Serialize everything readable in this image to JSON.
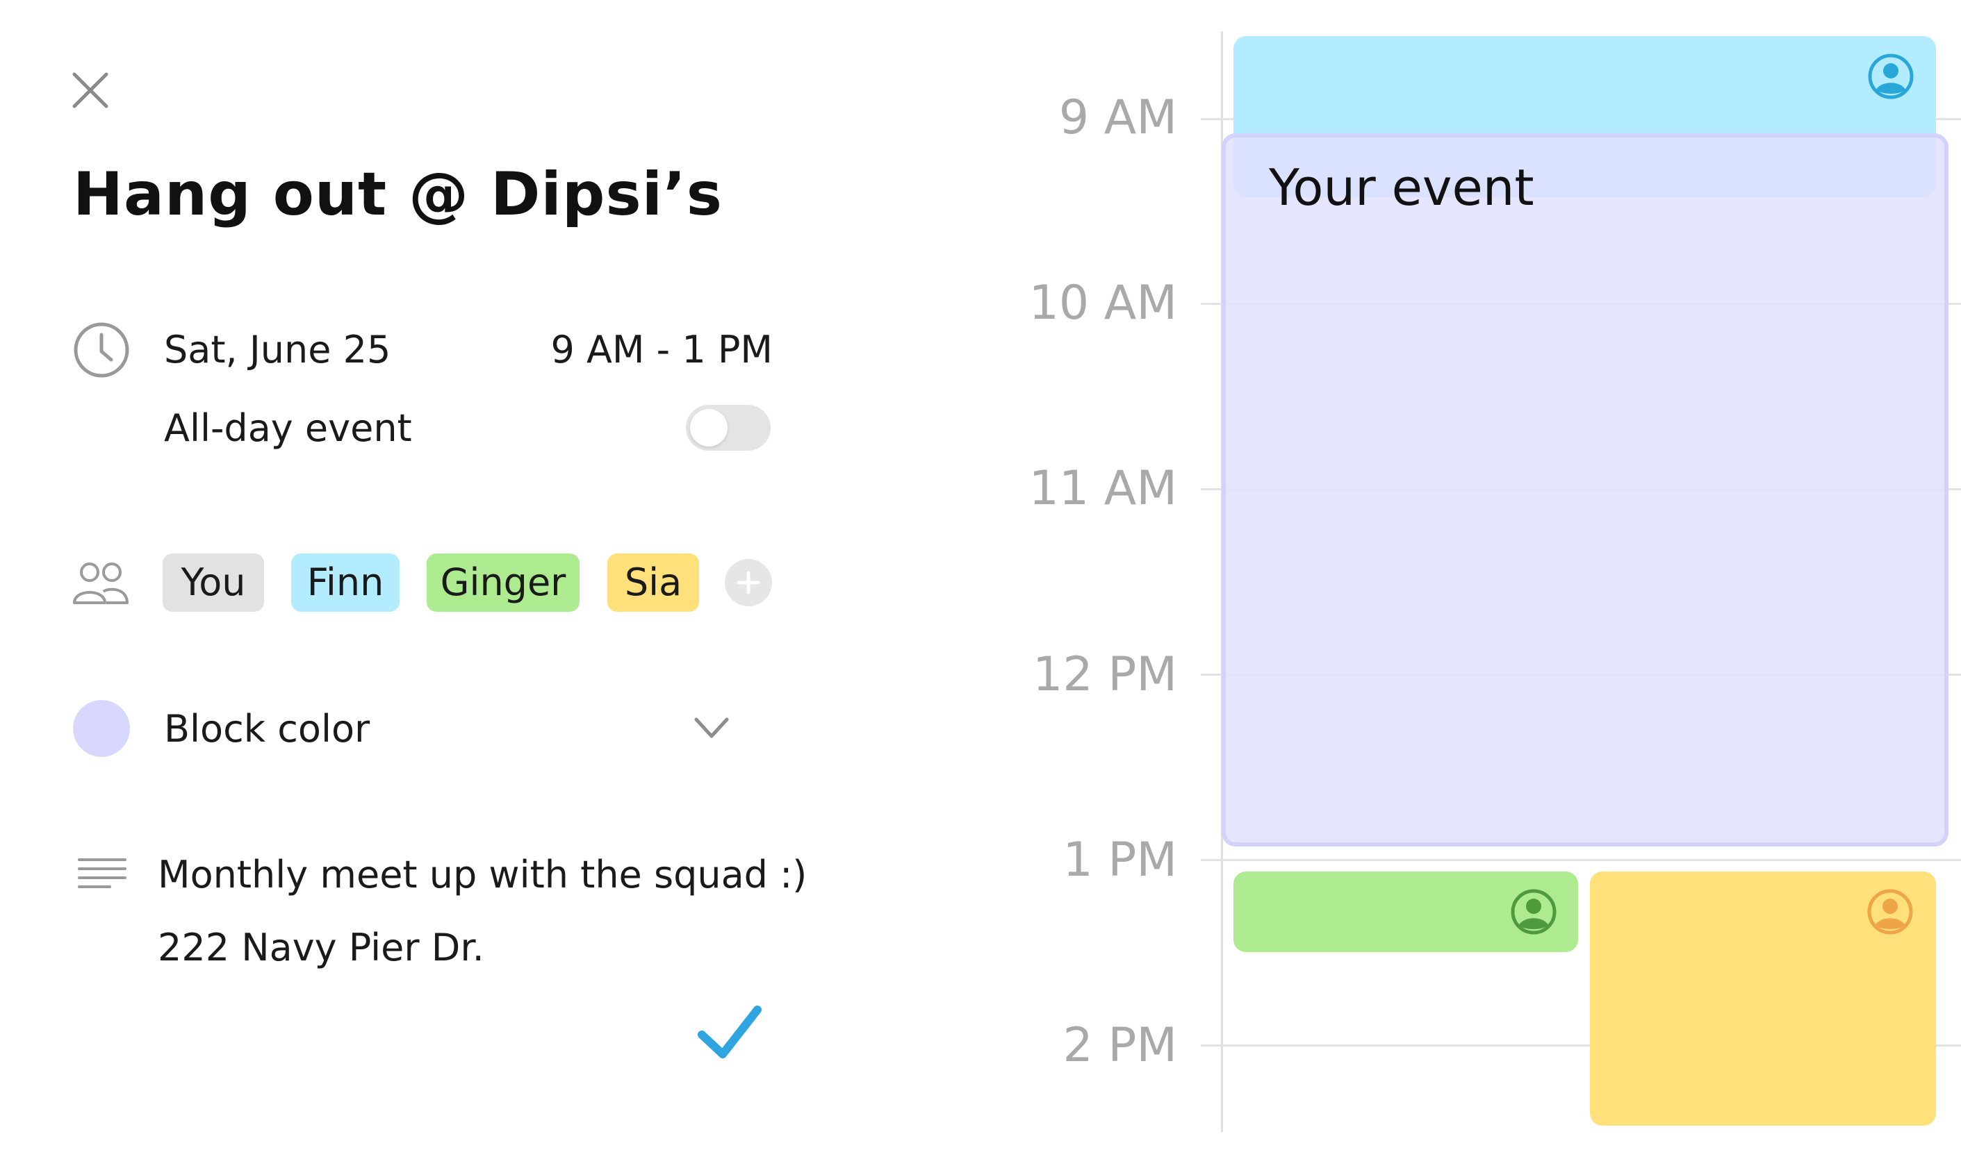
{
  "event": {
    "title": "Hang out @ Dipsi’s",
    "date": "Sat, June 25",
    "time_range": "9 AM - 1 PM",
    "all_day_label": "All-day event",
    "all_day_enabled": false
  },
  "attendees": [
    {
      "name": "You",
      "color": "#e2e2e2"
    },
    {
      "name": "Finn",
      "color": "#b4ecff"
    },
    {
      "name": "Ginger",
      "color": "#aeea90"
    },
    {
      "name": "Sia",
      "color": "#ffe07a"
    }
  ],
  "block_color": {
    "label": "Block color",
    "value": "#d8d8ff"
  },
  "description": {
    "line1": "Monthly meet up with the squad :)",
    "line2": "222 Navy Pier Dr."
  },
  "calendar": {
    "hours": [
      "9 AM",
      "10 AM",
      "11 AM",
      "12 PM",
      "1 PM",
      "2 PM"
    ],
    "your_event_label": "Your event",
    "colors": {
      "finn_block": "#b4ecff",
      "finn_icon": "#2aa7d9",
      "your_event": "#e0e0ff",
      "your_event_border": "#d2d2fb",
      "ginger_block": "#aeea90",
      "ginger_icon": "#4e9a3c",
      "sia_block": "#ffe07a",
      "sia_icon": "#eea548",
      "confirm_check": "#2ea5e0"
    }
  },
  "icons": {
    "close": "close-icon",
    "clock": "clock-icon",
    "people": "people-icon",
    "add": "plus-icon",
    "chevron": "chevron-down-icon",
    "description": "description-lines-icon",
    "confirm": "checkmark-icon",
    "user": "user-circle-icon"
  }
}
